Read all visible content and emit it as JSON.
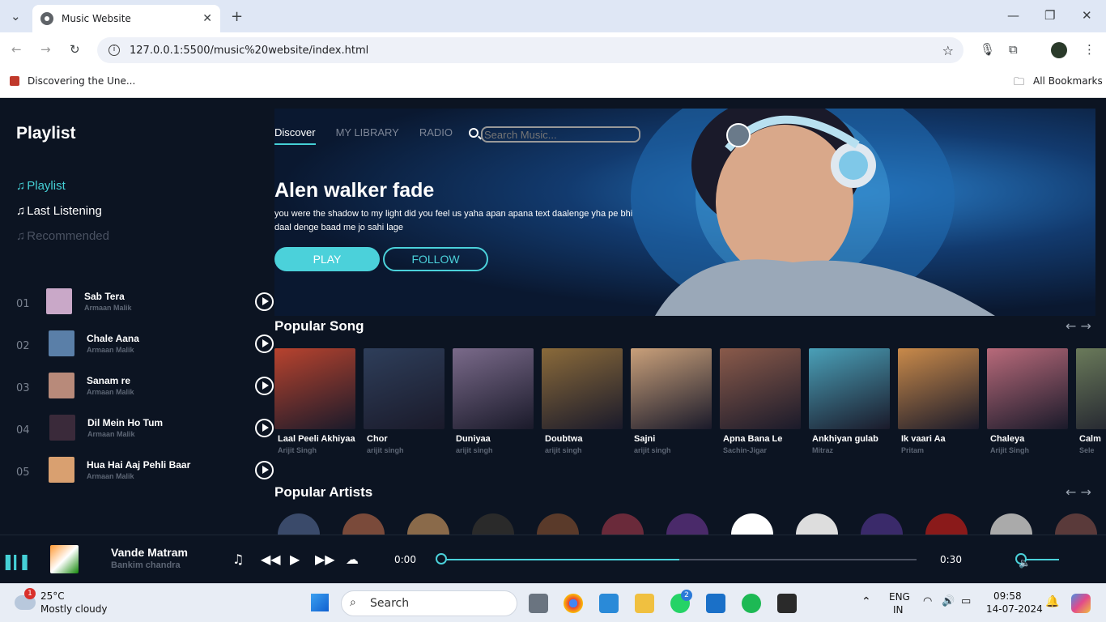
{
  "browser": {
    "tab_title": "Music Website",
    "url": "127.0.0.1:5500/music%20website/index.html",
    "bookmark": "Discovering the Une...",
    "all_bookmarks": "All Bookmarks"
  },
  "sidebar": {
    "title": "Playlist",
    "menu": [
      {
        "label": "Playlist",
        "color": "#45d0d6"
      },
      {
        "label": "Last Listening",
        "color": "#ffffff"
      },
      {
        "label": "Recommended",
        "color": "#4a5262"
      }
    ],
    "songs": [
      {
        "num": "01",
        "title": "Sab Tera",
        "artist": "Armaan Malik",
        "thumb_color": "#c9a8c8"
      },
      {
        "num": "02",
        "title": "Chale Aana",
        "artist": "Armaan Malik",
        "thumb_color": "#5a7fa8"
      },
      {
        "num": "03",
        "title": "Sanam re",
        "artist": "Armaan Malik",
        "thumb_color": "#b88a7a"
      },
      {
        "num": "04",
        "title": "Dil Mein Ho Tum",
        "artist": "Armaan Malik",
        "thumb_color": "#3a2a3a"
      },
      {
        "num": "05",
        "title": "Hua Hai Aaj Pehli Baar",
        "artist": "Armaan Malik",
        "thumb_color": "#d9a070"
      }
    ]
  },
  "hero": {
    "nav": [
      "Discover",
      "MY LIBRARY",
      "RADIO"
    ],
    "search_placeholder": "Search Music...",
    "title": "Alen walker fade",
    "description": "you were the shadow to my light did you feel us yaha apan apana text daalenge yha pe bhi daal denge baad me jo sahi lage",
    "play_label": "PLAY",
    "follow_label": "FOLLOW"
  },
  "popular_songs": {
    "heading": "Popular Song",
    "items": [
      {
        "title": "Laal Peeli Akhiyaan",
        "artist": "Arijit Singh",
        "color": "#b8432e"
      },
      {
        "title": "Chor",
        "artist": "arijit singh",
        "color": "#2e3e5a"
      },
      {
        "title": "Duniyaa",
        "artist": "arijit singh",
        "color": "#7a6a8a"
      },
      {
        "title": "Doubtwa",
        "artist": "arijit singh",
        "color": "#8a6a3a"
      },
      {
        "title": "Sajni",
        "artist": "arijit singh",
        "color": "#c9a07a"
      },
      {
        "title": "Apna Bana Le",
        "artist": "Sachin-Jigar",
        "color": "#8a5a4a"
      },
      {
        "title": "Ankhiyan gulab",
        "artist": "Mitraz",
        "color": "#4aa0b8"
      },
      {
        "title": "Ik vaari Aa",
        "artist": "Pritam",
        "color": "#c98a4a"
      },
      {
        "title": "Chaleya",
        "artist": "Arijit Singh",
        "color": "#b86a7a"
      },
      {
        "title": "Calm",
        "artist": "Sele",
        "color": "#6a7a5a"
      }
    ]
  },
  "popular_artists": {
    "heading": "Popular Artists",
    "colors": [
      "#3a4a6a",
      "#7a4a3a",
      "#8a6a4a",
      "#2a2a2a",
      "#5a3a2a",
      "#6a2a3a",
      "#4a2a6a",
      "#ffffff",
      "#dddddd",
      "#3a2a6a",
      "#8a1a1a",
      "#aaaaaa",
      "#5a3a3a"
    ]
  },
  "player": {
    "title": "Vande Matram",
    "artist": "Bankim chandra",
    "current_time": "0:00",
    "duration": "0:30",
    "progress": 0.5,
    "volume": 0.9
  },
  "taskbar": {
    "weather_temp": "25°C",
    "weather_desc": "Mostly cloudy",
    "weather_badge": "1",
    "search_label": "Search",
    "whatsapp_badge": "2",
    "lang_top": "ENG",
    "lang_bottom": "IN",
    "time": "09:58",
    "date": "14-07-2024"
  },
  "colors": {
    "accent": "#45d0d6",
    "bg": "#0c1422"
  }
}
